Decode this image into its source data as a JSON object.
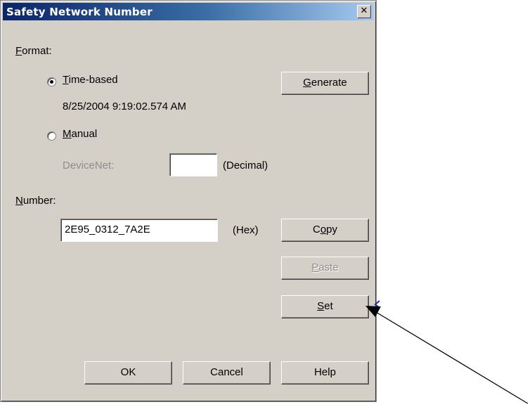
{
  "dialog": {
    "title": "Safety Network Number",
    "close_glyph": "✕"
  },
  "format": {
    "label_key": "F",
    "label_rest": "ormat:",
    "time_based": {
      "key": "T",
      "rest": "ime-based",
      "selected": true
    },
    "timestamp": "8/25/2004 9:19:02.574 AM",
    "manual": {
      "key": "M",
      "rest": "anual",
      "selected": false
    },
    "devicenet_label": "DeviceNet:",
    "devicenet_value": "",
    "decimal_label": "(Decimal)"
  },
  "number": {
    "label_key": "N",
    "label_rest": "umber:",
    "value": "2E95_0312_7A2E",
    "hex_label": "(Hex)"
  },
  "buttons": {
    "generate": {
      "key": "G",
      "rest": "enerate"
    },
    "copy": {
      "pre": "C",
      "key": "o",
      "rest": "py"
    },
    "paste": {
      "key": "P",
      "rest": "aste"
    },
    "set": {
      "key": "S",
      "rest": "et"
    },
    "ok": "OK",
    "cancel": "Cancel",
    "help": "Help"
  },
  "annotation": {
    "arrow_color": "#000000",
    "cursor_color": "#1a2fb0"
  }
}
